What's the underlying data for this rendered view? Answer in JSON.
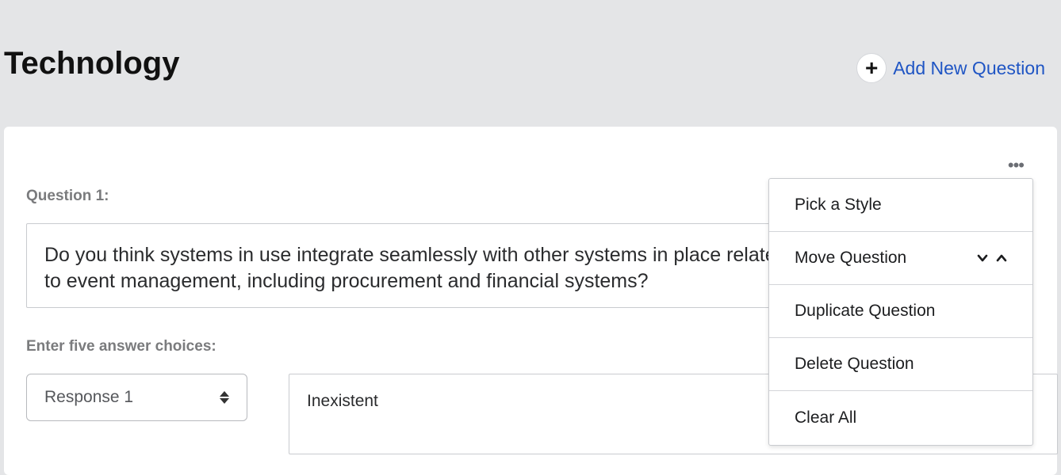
{
  "header": {
    "title": "Technology",
    "add_question_label": "Add New Question",
    "add_icon": "plus-icon"
  },
  "question": {
    "label": "Question 1:",
    "text": "Do you think systems in use integrate seamlessly with other systems in place related to event management, including procurement and financial systems?",
    "choices_label": "Enter five answer choices:",
    "response_select": "Response 1",
    "answer_value": "Inexistent"
  },
  "menu": {
    "items": [
      {
        "label": "Pick a Style"
      },
      {
        "label": "Move Question"
      },
      {
        "label": "Duplicate Question"
      },
      {
        "label": "Delete Question"
      },
      {
        "label": "Clear All"
      }
    ]
  },
  "colors": {
    "link": "#1f55c4",
    "header_bg": "#e4e5e7"
  }
}
